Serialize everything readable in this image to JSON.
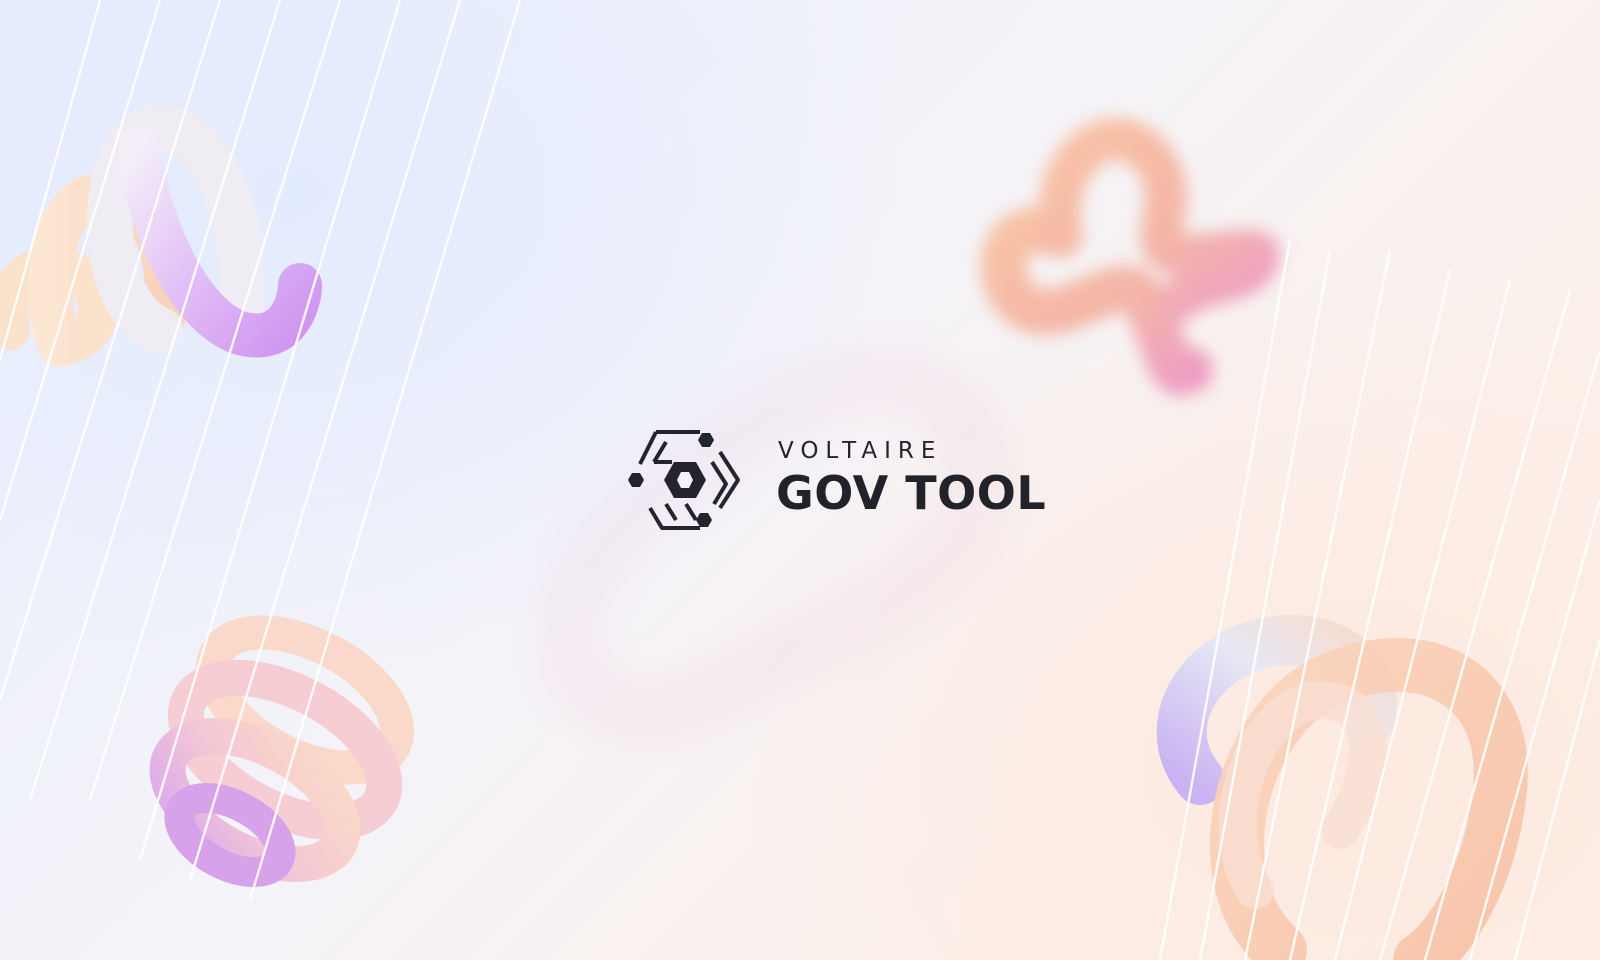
{
  "brand": {
    "name_line1": "VOLTAIRE",
    "name_line2": "GOV TOOL",
    "logo_icon": "hexagon-network-icon",
    "text_color": "#22222a"
  },
  "theme": {
    "background_cool": "#e8eefd",
    "background_warm": "#fcefe8",
    "accent_purple": "#d7a4f2",
    "accent_peach": "#f8cfb4",
    "accent_pink": "#f1a6b6"
  }
}
